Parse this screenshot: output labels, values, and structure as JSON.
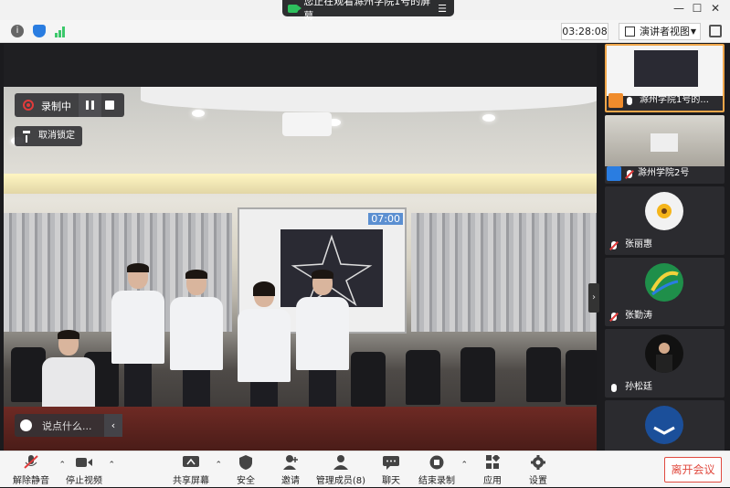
{
  "titlebar": {
    "share_notice": "您正在观看滁州学院1号的屏幕",
    "share_menu_icon": "menu-icon",
    "controls": [
      "minimize",
      "maximize",
      "close"
    ]
  },
  "status_bar": {
    "info_icon": "info-icon",
    "security_icon": "shield-icon",
    "signal_icon": "signal-icon",
    "timer": "03:28:08",
    "view_mode": "演讲者视图",
    "fullscreen_icon": "fullscreen-icon"
  },
  "recording": {
    "label": "录制中",
    "pause_icon": "pause-icon",
    "stop_icon": "stop-icon"
  },
  "unlock": {
    "label": "取消锁定"
  },
  "chat_input": {
    "placeholder": "说点什么..."
  },
  "presentation": {
    "clock": "07:00"
  },
  "participants": [
    {
      "name": "滁州学院1号的...",
      "mic": "on",
      "badge": "orange"
    },
    {
      "name": "滁州学院2号",
      "mic": "off",
      "badge": "blue"
    },
    {
      "name": "张丽惠",
      "mic": "off"
    },
    {
      "name": "张勤涛",
      "mic": "off"
    },
    {
      "name": "孙松廷",
      "mic": "on"
    },
    {
      "name": "",
      "mic": "off"
    }
  ],
  "toolbar": {
    "mute_label": "解除静音",
    "video_label": "停止视频",
    "share_label": "共享屏幕",
    "security_label": "安全",
    "invite_label": "邀请",
    "members_label": "管理成员(8)",
    "chat_label": "聊天",
    "end_record_label": "结束录制",
    "apps_label": "应用",
    "settings_label": "设置",
    "leave_label": "离开会议"
  },
  "colors": {
    "accent": "#e04a3f",
    "active_tile_border": "#f0a64a",
    "record_red": "#e23b3b",
    "mic_green": "#3cc86b",
    "badge_blue": "#2a7de1"
  }
}
